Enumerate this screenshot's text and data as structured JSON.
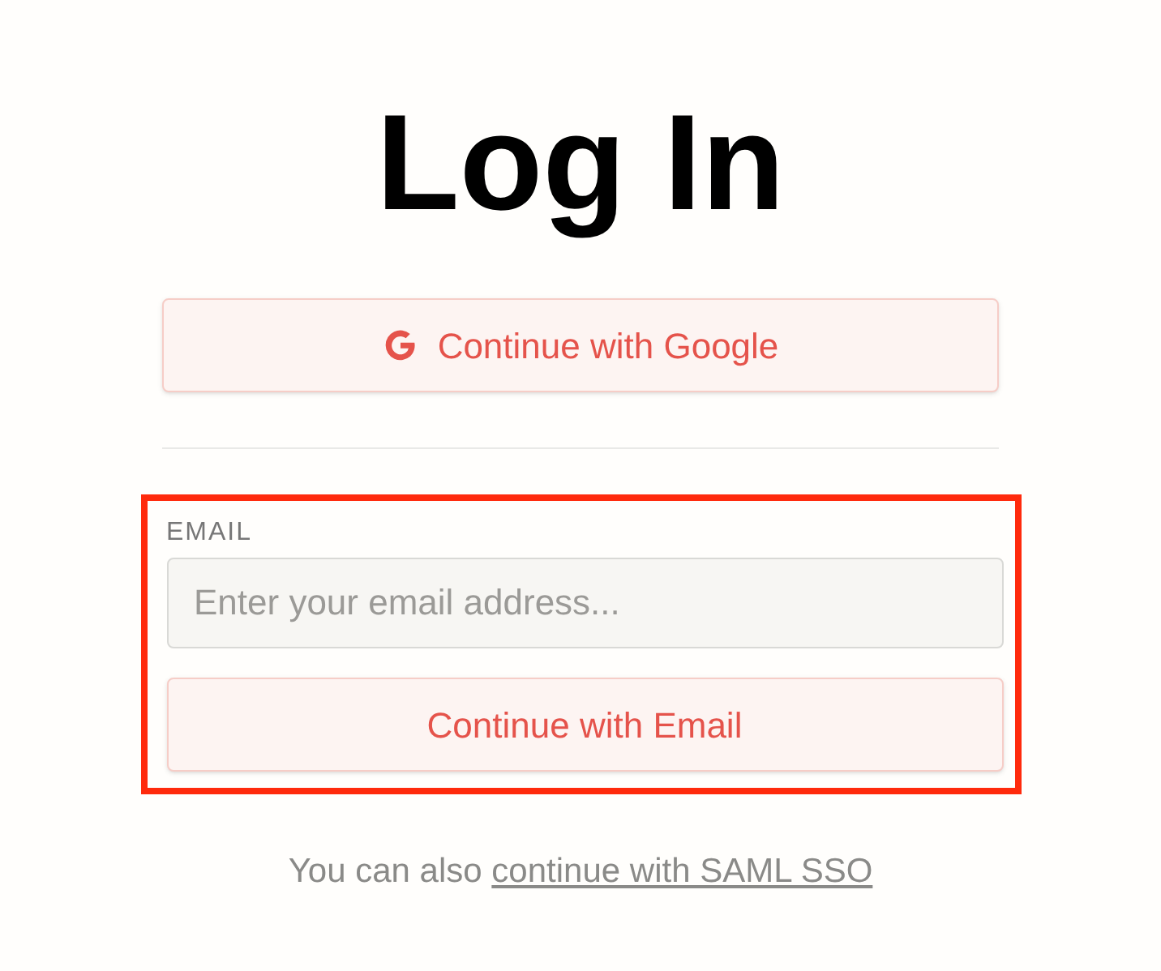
{
  "title": "Log In",
  "google_button": {
    "label": "Continue with Google"
  },
  "email_section": {
    "highlighted": true,
    "label": "EMAIL",
    "field": {
      "placeholder": "Enter your email address..."
    },
    "button": {
      "label": "Continue with Email"
    }
  },
  "footer": {
    "text": "You can also",
    "link": "continue with SAML SSO"
  }
}
